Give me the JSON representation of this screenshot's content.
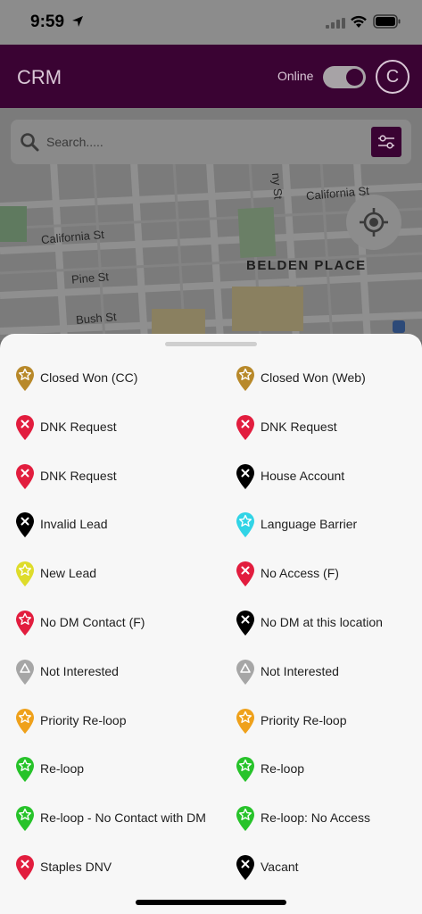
{
  "status_bar": {
    "time": "9:59"
  },
  "header": {
    "title": "CRM",
    "online_label": "Online",
    "avatar_initial": "C",
    "brand_color": "#5a0a51"
  },
  "search": {
    "placeholder": "Search....."
  },
  "map": {
    "streets": [
      "California St",
      "California St",
      "Pine St",
      "Bush St",
      "ny St"
    ],
    "district": "BELDEN PLACE"
  },
  "legend": {
    "items": [
      {
        "label": "Closed Won (CC)",
        "color": "#b8892a",
        "icon": "star-pin-icon"
      },
      {
        "label": "Closed Won (Web)",
        "color": "#b8892a",
        "icon": "star-pin-icon"
      },
      {
        "label": "DNK Request",
        "color": "#e21d3e",
        "icon": "x-pin-icon"
      },
      {
        "label": "DNK Request",
        "color": "#e21d3e",
        "icon": "x-pin-icon"
      },
      {
        "label": "DNK Request",
        "color": "#e21d3e",
        "icon": "x-pin-icon"
      },
      {
        "label": "House Account",
        "color": "#000000",
        "icon": "x-pin-icon"
      },
      {
        "label": "Invalid Lead",
        "color": "#000000",
        "icon": "x-pin-icon"
      },
      {
        "label": "Language Barrier",
        "color": "#31d4e6",
        "icon": "star-pin-icon"
      },
      {
        "label": "New Lead",
        "color": "#dedc2b",
        "icon": "star-pin-icon"
      },
      {
        "label": "No Access (F)",
        "color": "#e21d3e",
        "icon": "x-pin-icon"
      },
      {
        "label": "No DM Contact (F)",
        "color": "#e21d3e",
        "icon": "star-pin-icon"
      },
      {
        "label": "No DM at this location",
        "color": "#000000",
        "icon": "x-pin-icon"
      },
      {
        "label": "Not Interested",
        "color": "#a6a6a6",
        "icon": "triangle-pin-icon"
      },
      {
        "label": "Not Interested",
        "color": "#a6a6a6",
        "icon": "triangle-pin-icon"
      },
      {
        "label": "Priority Re-loop",
        "color": "#efa11b",
        "icon": "star-pin-icon"
      },
      {
        "label": "Priority Re-loop",
        "color": "#efa11b",
        "icon": "star-pin-icon"
      },
      {
        "label": "Re-loop",
        "color": "#27c32a",
        "icon": "star-pin-icon"
      },
      {
        "label": "Re-loop",
        "color": "#27c32a",
        "icon": "star-pin-icon"
      },
      {
        "label": "Re-loop - No Contact with DM",
        "color": "#27c32a",
        "icon": "star-pin-icon"
      },
      {
        "label": "Re-loop: No Access",
        "color": "#27c32a",
        "icon": "star-pin-icon"
      },
      {
        "label": "Staples DNV",
        "color": "#e21d3e",
        "icon": "x-pin-icon"
      },
      {
        "label": "Vacant",
        "color": "#000000",
        "icon": "x-pin-icon"
      }
    ]
  }
}
